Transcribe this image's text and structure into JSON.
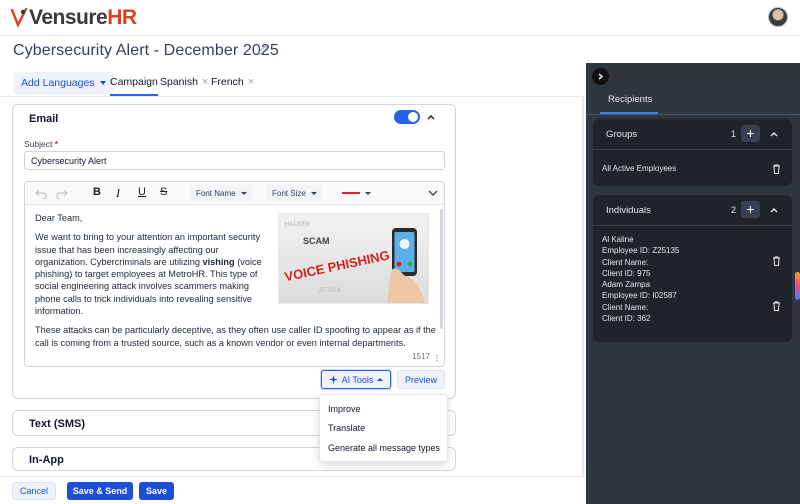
{
  "app": {
    "logo_prefix": "Vensure",
    "logo_suffix": "HR"
  },
  "page": {
    "title": "Cybersecurity Alert - December 2025"
  },
  "tabs": {
    "add_languages": "Add Languages",
    "items": [
      {
        "label": "Campaign",
        "active": true,
        "closable": false
      },
      {
        "label": "Spanish",
        "active": false,
        "closable": true
      },
      {
        "label": "French",
        "active": false,
        "closable": true
      }
    ],
    "close_glyph": "×"
  },
  "email": {
    "title": "Email",
    "enabled": true,
    "subject_label": "Subject",
    "required_mark": "*",
    "subject_value": "Cybersecurity Alert",
    "toolbar": {
      "bold": "B",
      "italic": "I",
      "underline": "U",
      "strike": "S",
      "font_name": "Font Name",
      "font_size": "Font Size"
    },
    "body": {
      "greeting": "Dear Team,",
      "p1_before": "We want to bring to your attention an important security issue that has been increasingly affecting our organization. Cybercriminals are utilizing ",
      "p1_bold": "vishing",
      "p1_after": " (voice phishing) to target employees at MetroHR. This type of social engineering attack involves scammers making phone calls to trick individuals into revealing sensitive information.",
      "p2": "These attacks can be particularly deceptive, as they often use caller ID spoofing to appear as if the call is coming from a trusted source, such as a known vendor or even internal departments."
    },
    "image_words": {
      "main": "VOICE PHISHING",
      "w1": "SCAM",
      "w2": "ATTACK",
      "w3": "HACKER"
    },
    "char_count": "1517",
    "ai_tools": "AI Tools",
    "preview": "Preview"
  },
  "ai_menu": {
    "items": [
      "Improve",
      "Translate",
      "Generate all message types"
    ]
  },
  "sms": {
    "title": "Text (SMS)"
  },
  "inapp": {
    "title": "In-App"
  },
  "footer": {
    "cancel": "Cancel",
    "save_send": "Save & Send",
    "save": "Save"
  },
  "panel": {
    "tab": "Recipients",
    "groups": {
      "title": "Groups",
      "count": "1",
      "items": [
        "All Active Employees"
      ]
    },
    "individuals": {
      "title": "Individuals",
      "count": "2",
      "items": [
        {
          "name": "Al Kaline",
          "employee_id": "Employee ID: Z25135",
          "client_name": "Client Name:",
          "client_id": "Client ID: 975"
        },
        {
          "name": "Adam Zampa",
          "employee_id": "Employee ID: I02587",
          "client_name": "Client Name:",
          "client_id": "Client ID: 362"
        }
      ]
    }
  },
  "colors": {
    "accent": "#1d4ed8",
    "panel_bg": "#2f3640",
    "logo_hr": "#e0401f",
    "danger": "#dc2626"
  }
}
